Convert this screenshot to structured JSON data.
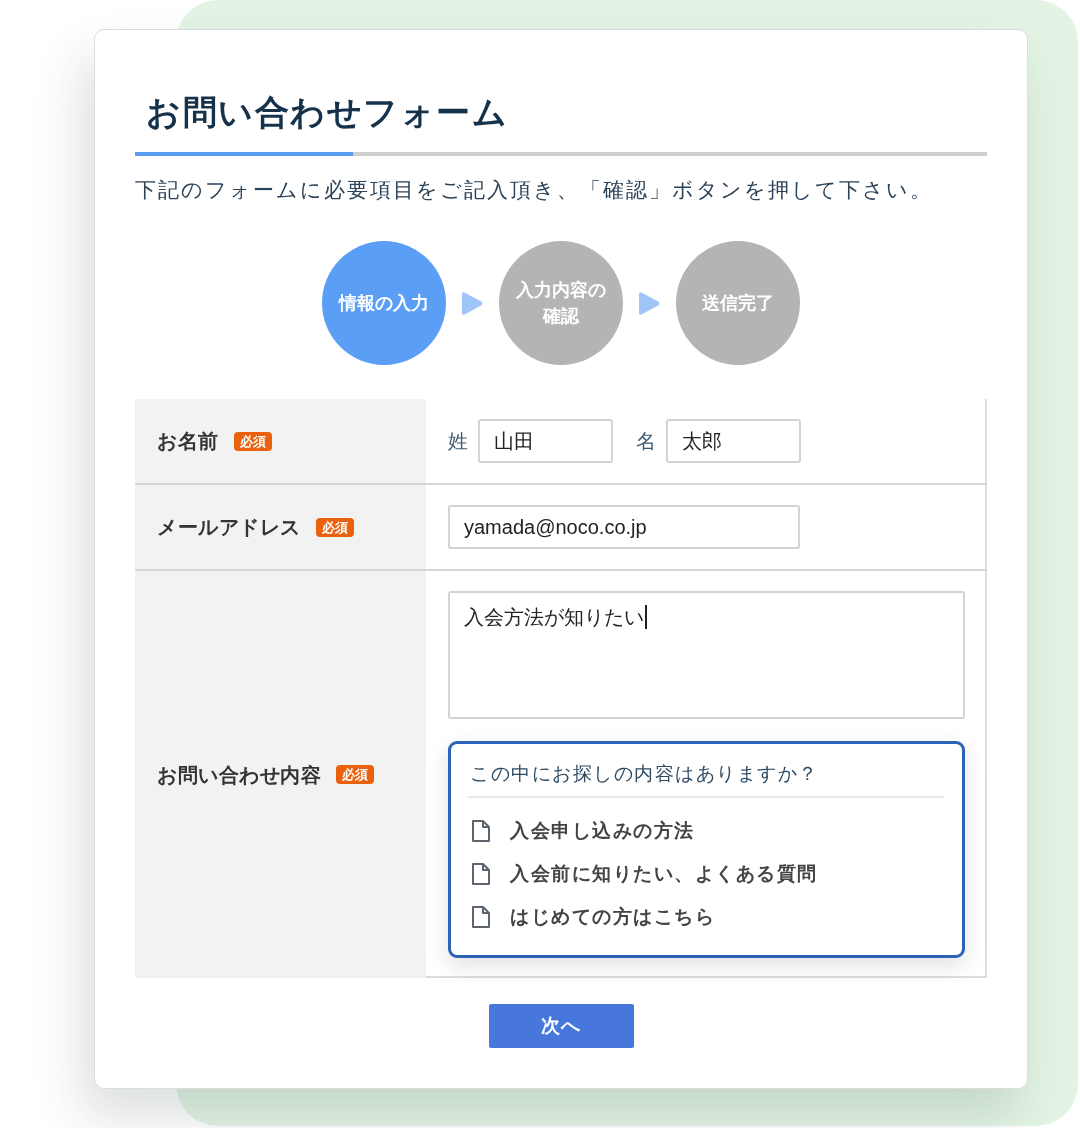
{
  "form": {
    "title": "お問い合わせフォーム",
    "intro": "下記のフォームに必要項目をご記入頂き、「確認」ボタンを押して下さい。"
  },
  "steps": [
    {
      "label": "情報の入力",
      "selected": true
    },
    {
      "label": "入力内容の確認",
      "selected": false
    },
    {
      "label": "送信完了",
      "selected": false
    }
  ],
  "fields": [
    {
      "kind": "name",
      "label": "お名前",
      "badge": "必須",
      "parts": [
        {
          "label": "姓",
          "value": "山田"
        },
        {
          "label": "名",
          "value": "太郎"
        }
      ]
    },
    {
      "kind": "email",
      "label": "メールアドレス",
      "badge": "必須",
      "value": "yamada@noco.co.jp"
    },
    {
      "kind": "message",
      "label": "お問い合わせ内容",
      "badge": "必須",
      "value": "入会方法が知りたい",
      "focused": true,
      "suggestions": {
        "heading": "この中にお探しの内容はありますか？",
        "items": [
          "入会申し込みの方法",
          "入会前に知りたい、よくある質問",
          "はじめての方はこちら"
        ]
      }
    }
  ],
  "next_button": {
    "label": "次へ"
  }
}
